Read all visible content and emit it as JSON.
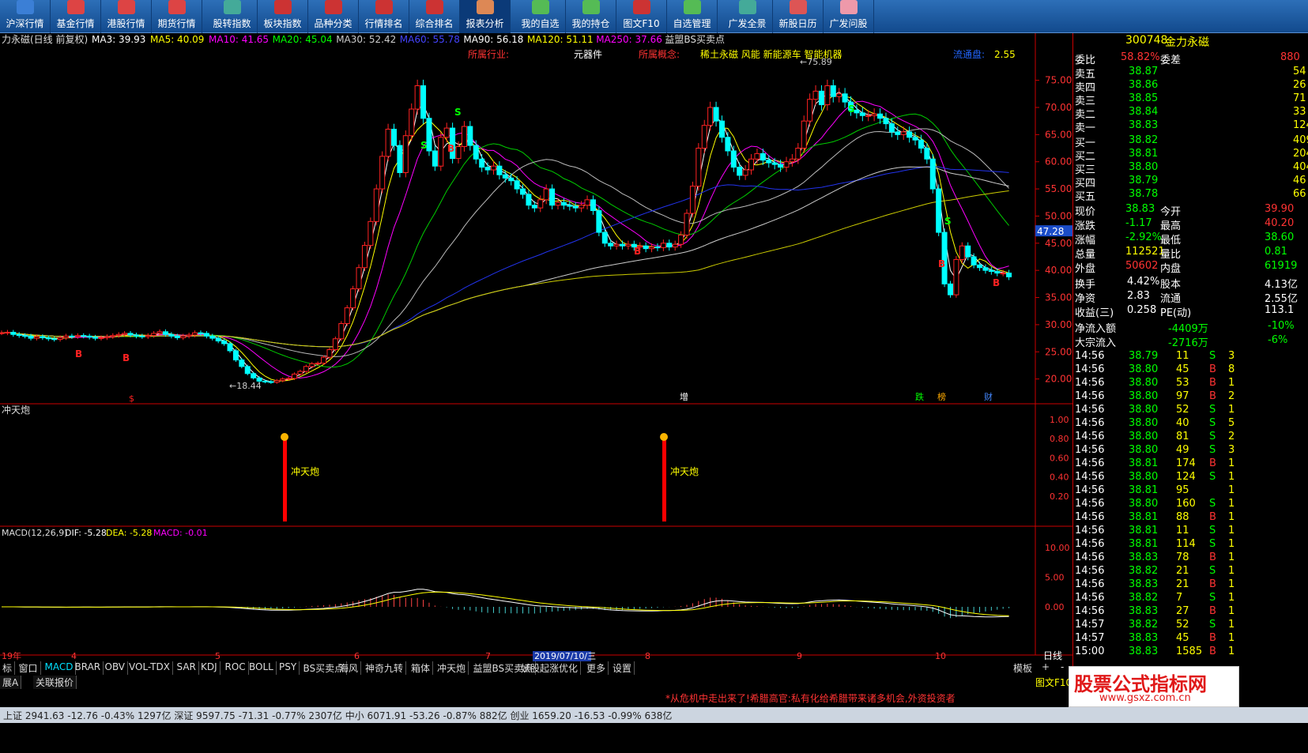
{
  "toolbar": [
    {
      "label": "沪深行情",
      "color": "#3b7fd6"
    },
    {
      "label": "基金行情",
      "color": "#d44"
    },
    {
      "label": "港股行情",
      "color": "#d44"
    },
    {
      "label": "期货行情",
      "color": "#d44"
    },
    {
      "label": "股转指数",
      "color": "#4a9"
    },
    {
      "label": "板块指数",
      "color": "#c33"
    },
    {
      "label": "品种分类",
      "color": "#c33"
    },
    {
      "label": "行情排名",
      "color": "#c33"
    },
    {
      "label": "综合排名",
      "color": "#c33"
    },
    {
      "label": "报表分析",
      "color": "#d85"
    },
    {
      "label": "我的自选",
      "color": "#5b5"
    },
    {
      "label": "我的持仓",
      "color": "#5b5"
    },
    {
      "label": "图文F10",
      "color": "#c33"
    },
    {
      "label": "自选管理",
      "color": "#5b5"
    },
    {
      "label": "广发全景",
      "color": "#4a9"
    },
    {
      "label": "新股日历",
      "color": "#d55"
    },
    {
      "label": "广发问股",
      "color": "#e9a"
    }
  ],
  "main": {
    "title": "力永磁(日线 前复权)",
    "ma": [
      {
        "t": "MA3: 39.93",
        "c": "#fff"
      },
      {
        "t": "MA5: 40.09",
        "c": "#ff0"
      },
      {
        "t": "MA10: 41.65",
        "c": "#f0f"
      },
      {
        "t": "MA20: 45.04",
        "c": "#0f0"
      },
      {
        "t": "MA30: 52.42",
        "c": "#ccc"
      },
      {
        "t": "MA60: 55.78",
        "c": "#44f"
      },
      {
        "t": "MA90: 56.18",
        "c": "#fff"
      },
      {
        "t": "MA120: 51.11",
        "c": "#ff0"
      },
      {
        "t": "MA250: 37.66",
        "c": "#f0f"
      },
      {
        "t": "益盟BS买卖点",
        "c": "#ddd"
      }
    ],
    "industry_label": "所属行业:",
    "industry": "元器件",
    "concept_label": "所属概念:",
    "concept": "稀土永磁 风能 新能源车 智能机器",
    "float_label": "流通盘:",
    "float_val": "2.55",
    "high_label": "75.89",
    "low_label": "18.44",
    "cur_price": "47.28",
    "ylabels": [
      "75.00",
      "70.00",
      "65.00",
      "60.00",
      "55.00",
      "50.00",
      "45.00",
      "40.00",
      "35.00",
      "30.00",
      "25.00",
      "20.00"
    ],
    "markers": [
      "$",
      "增",
      "跌",
      "榜",
      "财"
    ]
  },
  "ctp": {
    "title": "冲天炮",
    "label": "冲天炮",
    "ylabels": [
      "1.00",
      "0.80",
      "0.60",
      "0.40",
      "0.20"
    ]
  },
  "macd": {
    "title": "MACD(12,26,9)",
    "dif": "DIF: -5.28",
    "dea": "DEA: -5.28",
    "macd": "MACD: -0.01",
    "ylabels": [
      "10.00",
      "5.00",
      "0.00"
    ]
  },
  "xaxis": {
    "labels": [
      "19年",
      "4",
      "5",
      "6",
      "7",
      "8",
      "9",
      "10"
    ],
    "date": "2019/07/10/三",
    "period": "日线"
  },
  "chart_data": {
    "type": "candlestick",
    "ylim": [
      15,
      78
    ],
    "closes": [
      28.5,
      28.6,
      28.2,
      28.0,
      27.9,
      27.5,
      27.8,
      27.6,
      27.4,
      27.3,
      27.6,
      27.9,
      27.8,
      28.0,
      27.9,
      27.7,
      27.5,
      27.6,
      27.8,
      28.0,
      28.2,
      28.4,
      28.1,
      27.9,
      27.8,
      28.0,
      28.4,
      28.7,
      28.2,
      27.9,
      27.6,
      27.9,
      28.1,
      28.5,
      28.4,
      27.9,
      27.5,
      27.0,
      26.5,
      25.2,
      23.5,
      22.3,
      21.0,
      20.2,
      19.6,
      19.5,
      19.4,
      19.7,
      20.0,
      20.1,
      20.9,
      21.4,
      22.3,
      22.8,
      22.9,
      24.0,
      25.4,
      27.4,
      30.2,
      33.1,
      36.6,
      40.5,
      44.6,
      49.0,
      55.0,
      61.0,
      66.0,
      63.0,
      58.0,
      64.8,
      69.7,
      74.0,
      68.0,
      62.0,
      59.2,
      64.5,
      66.2,
      60.6,
      62.8,
      66.5,
      63.0,
      60.5,
      59.0,
      58.5,
      59.2,
      57.6,
      57.0,
      56.5,
      55.0,
      54.0,
      52.0,
      51.5,
      53.0,
      55.0,
      52.0,
      52.5,
      52.0,
      51.8,
      51.5,
      52.0,
      53.0,
      51.0,
      47.0,
      45.0,
      44.5,
      44.8,
      44.5,
      44.8,
      44.3,
      44.5,
      44.0,
      44.3,
      44.2,
      45.0,
      44.3,
      44.8,
      46.5,
      50.5,
      55.5,
      62.5,
      66.7,
      70.0,
      67.5,
      64.5,
      62.0,
      59.0,
      57.5,
      58.5,
      60.5,
      61.5,
      60.3,
      59.8,
      59.5,
      59.0,
      60.0,
      60.5,
      62.5,
      67.5,
      71.5,
      73.0,
      70.5,
      74.0,
      72.0,
      72.5,
      71.0,
      69.5,
      69.0,
      68.5,
      68.5,
      68.8,
      68.0,
      67.0,
      65.5,
      65.0,
      65.5,
      64.5,
      64.0,
      62.5,
      60.5,
      55.0,
      47.0,
      37.5,
      35.5,
      42.0,
      44.5,
      42.5,
      41.0,
      40.5,
      40.0,
      39.8,
      39.5,
      39.5,
      38.8
    ]
  },
  "right": {
    "code": "300748",
    "name": "金力永磁",
    "wb_label": "委比",
    "wb": "58.82%",
    "wc_label": "委差",
    "wc": "880",
    "sells": [
      {
        "l": "卖五",
        "p": "38.87",
        "v": "54"
      },
      {
        "l": "卖四",
        "p": "38.86",
        "v": "26"
      },
      {
        "l": "卖三",
        "p": "38.85",
        "v": "71"
      },
      {
        "l": "卖二",
        "p": "38.84",
        "v": "33"
      },
      {
        "l": "卖一",
        "p": "38.83",
        "v": "124"
      }
    ],
    "buys": [
      {
        "l": "买一",
        "p": "38.82",
        "v": "409"
      },
      {
        "l": "买二",
        "p": "38.81",
        "v": "204"
      },
      {
        "l": "买三",
        "p": "38.80",
        "v": "404"
      },
      {
        "l": "买四",
        "p": "38.79",
        "v": "46"
      },
      {
        "l": "买五",
        "p": "38.78",
        "v": "66"
      }
    ],
    "stats": [
      {
        "l": "现价",
        "v": "38.83",
        "c": "#0f0",
        "l2": "今开",
        "v2": "39.90",
        "c2": "#f33"
      },
      {
        "l": "涨跌",
        "v": "-1.17",
        "c": "#0f0",
        "l2": "最高",
        "v2": "40.20",
        "c2": "#f33"
      },
      {
        "l": "涨幅",
        "v": "-2.92%",
        "c": "#0f0",
        "l2": "最低",
        "v2": "38.60",
        "c2": "#0f0"
      },
      {
        "l": "总量",
        "v": "112521",
        "c": "#ff0",
        "l2": "量比",
        "v2": "0.81",
        "c2": "#0f0"
      },
      {
        "l": "外盘",
        "v": "50602",
        "c": "#f33",
        "l2": "内盘",
        "v2": "61919",
        "c2": "#0f0"
      }
    ],
    "stats2": [
      {
        "l": "换手",
        "v": "4.42%",
        "l2": "股本",
        "v2": "4.13亿"
      },
      {
        "l": "净资",
        "v": "2.83",
        "l2": "流通",
        "v2": "2.55亿"
      },
      {
        "l": "收益(三)",
        "v": "0.258",
        "l2": "PE(动)",
        "v2": "113.1"
      }
    ],
    "flow": [
      {
        "l": "净流入额",
        "v": "-4409万",
        "v2": "-10%"
      },
      {
        "l": "大宗流入",
        "v": "-2716万",
        "v2": "-6%"
      }
    ],
    "ticks": [
      [
        "14:56",
        "38.79",
        "11",
        "S"
      ],
      [
        "14:56",
        "38.80",
        "45",
        "B"
      ],
      [
        "14:56",
        "38.80",
        "53",
        "B"
      ],
      [
        "14:56",
        "38.80",
        "97",
        "B"
      ],
      [
        "14:56",
        "38.80",
        "52",
        "S"
      ],
      [
        "14:56",
        "38.80",
        "40",
        "S"
      ],
      [
        "14:56",
        "38.80",
        "81",
        "S"
      ],
      [
        "14:56",
        "38.80",
        "49",
        "S"
      ],
      [
        "14:56",
        "38.81",
        "174",
        "B"
      ],
      [
        "14:56",
        "38.80",
        "124",
        "S"
      ],
      [
        "14:56",
        "38.81",
        "95",
        ""
      ],
      [
        "14:56",
        "38.80",
        "160",
        "S"
      ],
      [
        "14:56",
        "38.81",
        "88",
        "B"
      ],
      [
        "14:56",
        "38.81",
        "11",
        "S"
      ],
      [
        "14:56",
        "38.81",
        "114",
        "S"
      ],
      [
        "14:56",
        "38.83",
        "78",
        "B"
      ],
      [
        "14:56",
        "38.82",
        "21",
        "S"
      ],
      [
        "14:56",
        "38.83",
        "21",
        "B"
      ],
      [
        "14:56",
        "38.82",
        "7",
        "S"
      ],
      [
        "14:56",
        "38.83",
        "27",
        "B"
      ],
      [
        "14:57",
        "38.82",
        "52",
        "S"
      ],
      [
        "14:57",
        "38.83",
        "45",
        "B"
      ],
      [
        "15:00",
        "38.83",
        "1585",
        "B"
      ]
    ],
    "tick_cut": [
      "3",
      "8",
      "1",
      "2",
      "1",
      "5",
      "2",
      "3",
      "1",
      "1",
      "1",
      "1",
      "1",
      "1",
      "1",
      "1",
      "1",
      "1",
      "1",
      "1",
      "1",
      "1",
      "1"
    ]
  },
  "tabs": [
    "标",
    "窗口",
    "MACD",
    "BRAR",
    "OBV",
    "VOL-TDX",
    "SAR",
    "KDJ",
    "ROC",
    "BOLL",
    "PSY",
    "BS买卖点",
    "海风",
    "神奇九转",
    "箱体",
    "冲天炮",
    "益盟BS买卖点",
    "妖股起涨优化",
    "更多",
    "设置"
  ],
  "tab_right": [
    "+",
    "-"
  ],
  "tab_template": "模板",
  "row2": [
    "展A",
    "关联报价"
  ],
  "f10": "图文F10",
  "ticker": "*从危机中走出来了!希腊高官:私有化给希腊带来诸多机会,外资投资者",
  "watermark": "股票公式指标网",
  "watermark_url": "www.gsxz.com.cn",
  "indexbar": "上证 2941.63 -12.76 -0.43% 1297亿  深证 9597.75 -71.31 -0.77% 2307亿  中小 6071.91 -53.26 -0.87% 882亿  创业 1659.20 -16.53 -0.99% 638亿"
}
